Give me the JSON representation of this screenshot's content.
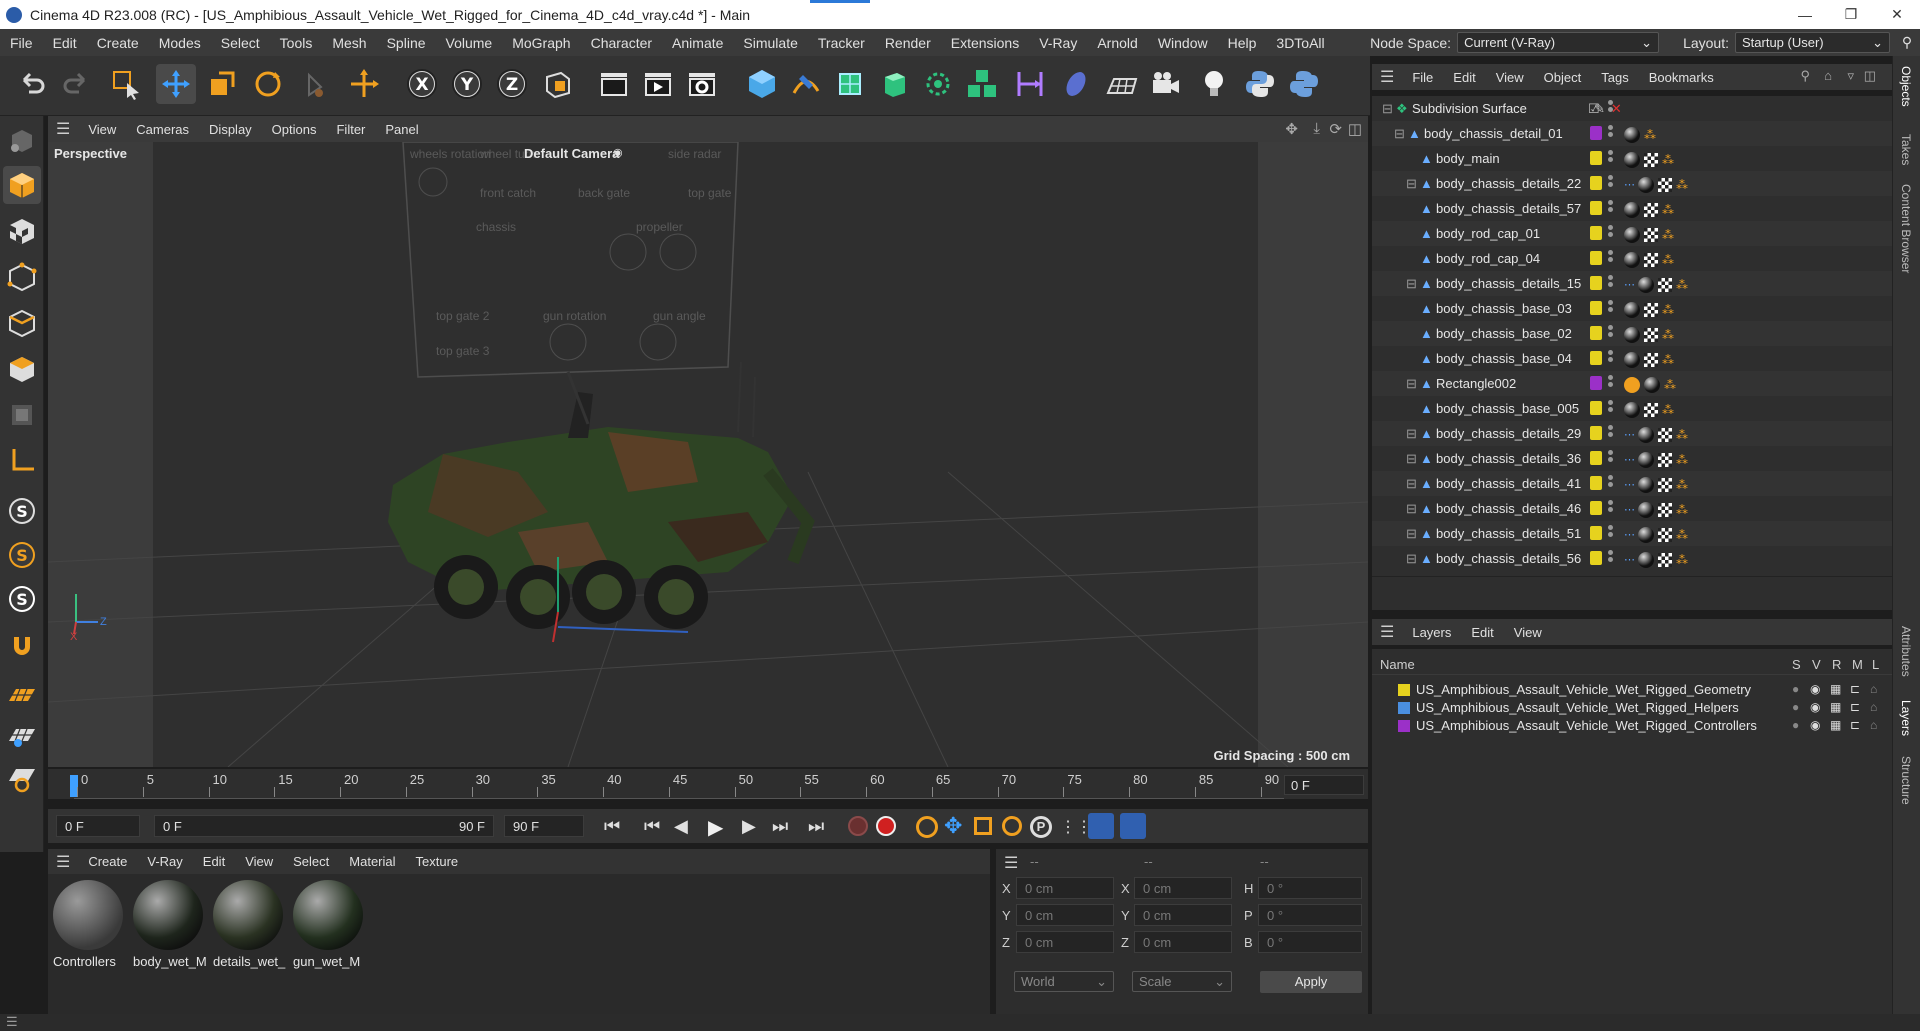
{
  "window": {
    "title": "Cinema 4D R23.008 (RC) - [US_Amphibious_Assault_Vehicle_Wet_Rigged_for_Cinema_4D_c4d_vray.c4d *] - Main"
  },
  "menubar": {
    "items": [
      "File",
      "Edit",
      "Create",
      "Modes",
      "Select",
      "Tools",
      "Mesh",
      "Spline",
      "Volume",
      "MoGraph",
      "Character",
      "Animate",
      "Simulate",
      "Tracker",
      "Render",
      "Extensions",
      "V-Ray",
      "Arnold",
      "Window",
      "Help",
      "3DToAll"
    ],
    "node_space_label": "Node Space:",
    "node_space_value": "Current (V-Ray)",
    "layout_label": "Layout:",
    "layout_value": "Startup (User)"
  },
  "viewport": {
    "menu": [
      "View",
      "Cameras",
      "Display",
      "Options",
      "Filter",
      "Panel"
    ],
    "view_name": "Perspective",
    "camera_label": "Default Camera",
    "grid_spacing": "Grid Spacing : 500 cm",
    "rig_labels": [
      "wheels rotation",
      "wheel turn",
      "side radar",
      "front catch",
      "back gate",
      "top gate",
      "chassis",
      "propeller",
      "top gate 2",
      "gun rotation",
      "gun angle",
      "top gate 3"
    ]
  },
  "timeline": {
    "ticks": [
      "0",
      "5",
      "10",
      "15",
      "20",
      "25",
      "30",
      "35",
      "40",
      "45",
      "50",
      "55",
      "60",
      "65",
      "70",
      "75",
      "80",
      "85",
      "90"
    ],
    "current_frame": "0 F"
  },
  "transport": {
    "start_field": "0 F",
    "range_start": "0 F",
    "range_end": "90 F",
    "end_field": "90 F"
  },
  "materials": {
    "menu": [
      "Create",
      "V-Ray",
      "Edit",
      "View",
      "Select",
      "Material",
      "Texture"
    ],
    "items": [
      "Controllers",
      "body_wet_M",
      "details_wet_",
      "gun_wet_M"
    ]
  },
  "coords": {
    "header": [
      "--",
      "--",
      "--"
    ],
    "rows": [
      {
        "a": "X",
        "av": "0 cm",
        "b": "X",
        "bv": "0 cm",
        "c": "H",
        "cv": "0 °"
      },
      {
        "a": "Y",
        "av": "0 cm",
        "b": "Y",
        "bv": "0 cm",
        "c": "P",
        "cv": "0 °"
      },
      {
        "a": "Z",
        "av": "0 cm",
        "b": "Z",
        "bv": "0 cm",
        "c": "B",
        "cv": "0 °"
      }
    ],
    "mode1": "World",
    "mode2": "Scale",
    "apply": "Apply"
  },
  "object_manager": {
    "menu": [
      "File",
      "Edit",
      "View",
      "Object",
      "Tags",
      "Bookmarks"
    ],
    "objects": [
      {
        "name": "Subdivision Surface",
        "color": "",
        "tags": "subdiv"
      },
      {
        "name": "body_chassis_detail_01",
        "color": "#9b30c8",
        "tags": "a"
      },
      {
        "name": "body_main",
        "color": "#e6d21e",
        "tags": "b"
      },
      {
        "name": "body_chassis_details_22",
        "color": "#e6d21e",
        "tags": "c"
      },
      {
        "name": "body_chassis_details_57",
        "color": "#e6d21e",
        "tags": "b"
      },
      {
        "name": "body_rod_cap_01",
        "color": "#e6d21e",
        "tags": "b"
      },
      {
        "name": "body_rod_cap_04",
        "color": "#e6d21e",
        "tags": "b"
      },
      {
        "name": "body_chassis_details_15",
        "color": "#e6d21e",
        "tags": "c"
      },
      {
        "name": "body_chassis_base_03",
        "color": "#e6d21e",
        "tags": "b"
      },
      {
        "name": "body_chassis_base_02",
        "color": "#e6d21e",
        "tags": "b"
      },
      {
        "name": "body_chassis_base_04",
        "color": "#e6d21e",
        "tags": "b"
      },
      {
        "name": "Rectangle002",
        "color": "#9b30c8",
        "tags": "d"
      },
      {
        "name": "body_chassis_base_005",
        "color": "#e6d21e",
        "tags": "b"
      },
      {
        "name": "body_chassis_details_29",
        "color": "#e6d21e",
        "tags": "c"
      },
      {
        "name": "body_chassis_details_36",
        "color": "#e6d21e",
        "tags": "c"
      },
      {
        "name": "body_chassis_details_41",
        "color": "#e6d21e",
        "tags": "c"
      },
      {
        "name": "body_chassis_details_46",
        "color": "#e6d21e",
        "tags": "c"
      },
      {
        "name": "body_chassis_details_51",
        "color": "#e6d21e",
        "tags": "c"
      },
      {
        "name": "body_chassis_details_56",
        "color": "#e6d21e",
        "tags": "c"
      }
    ]
  },
  "layers": {
    "menu": [
      "Layers",
      "Edit",
      "View"
    ],
    "col_name": "Name",
    "cols": [
      "S",
      "V",
      "R",
      "M",
      "L"
    ],
    "items": [
      {
        "name": "US_Amphibious_Assault_Vehicle_Wet_Rigged_Geometry",
        "color": "#e6d21e"
      },
      {
        "name": "US_Amphibious_Assault_Vehicle_Wet_Rigged_Helpers",
        "color": "#4a8fe0"
      },
      {
        "name": "US_Amphibious_Assault_Vehicle_Wet_Rigged_Controllers",
        "color": "#9b30c8"
      }
    ]
  },
  "right_tabs": [
    "Objects",
    "Takes",
    "Content Browser",
    "Attributes",
    "Layers",
    "Structure"
  ]
}
